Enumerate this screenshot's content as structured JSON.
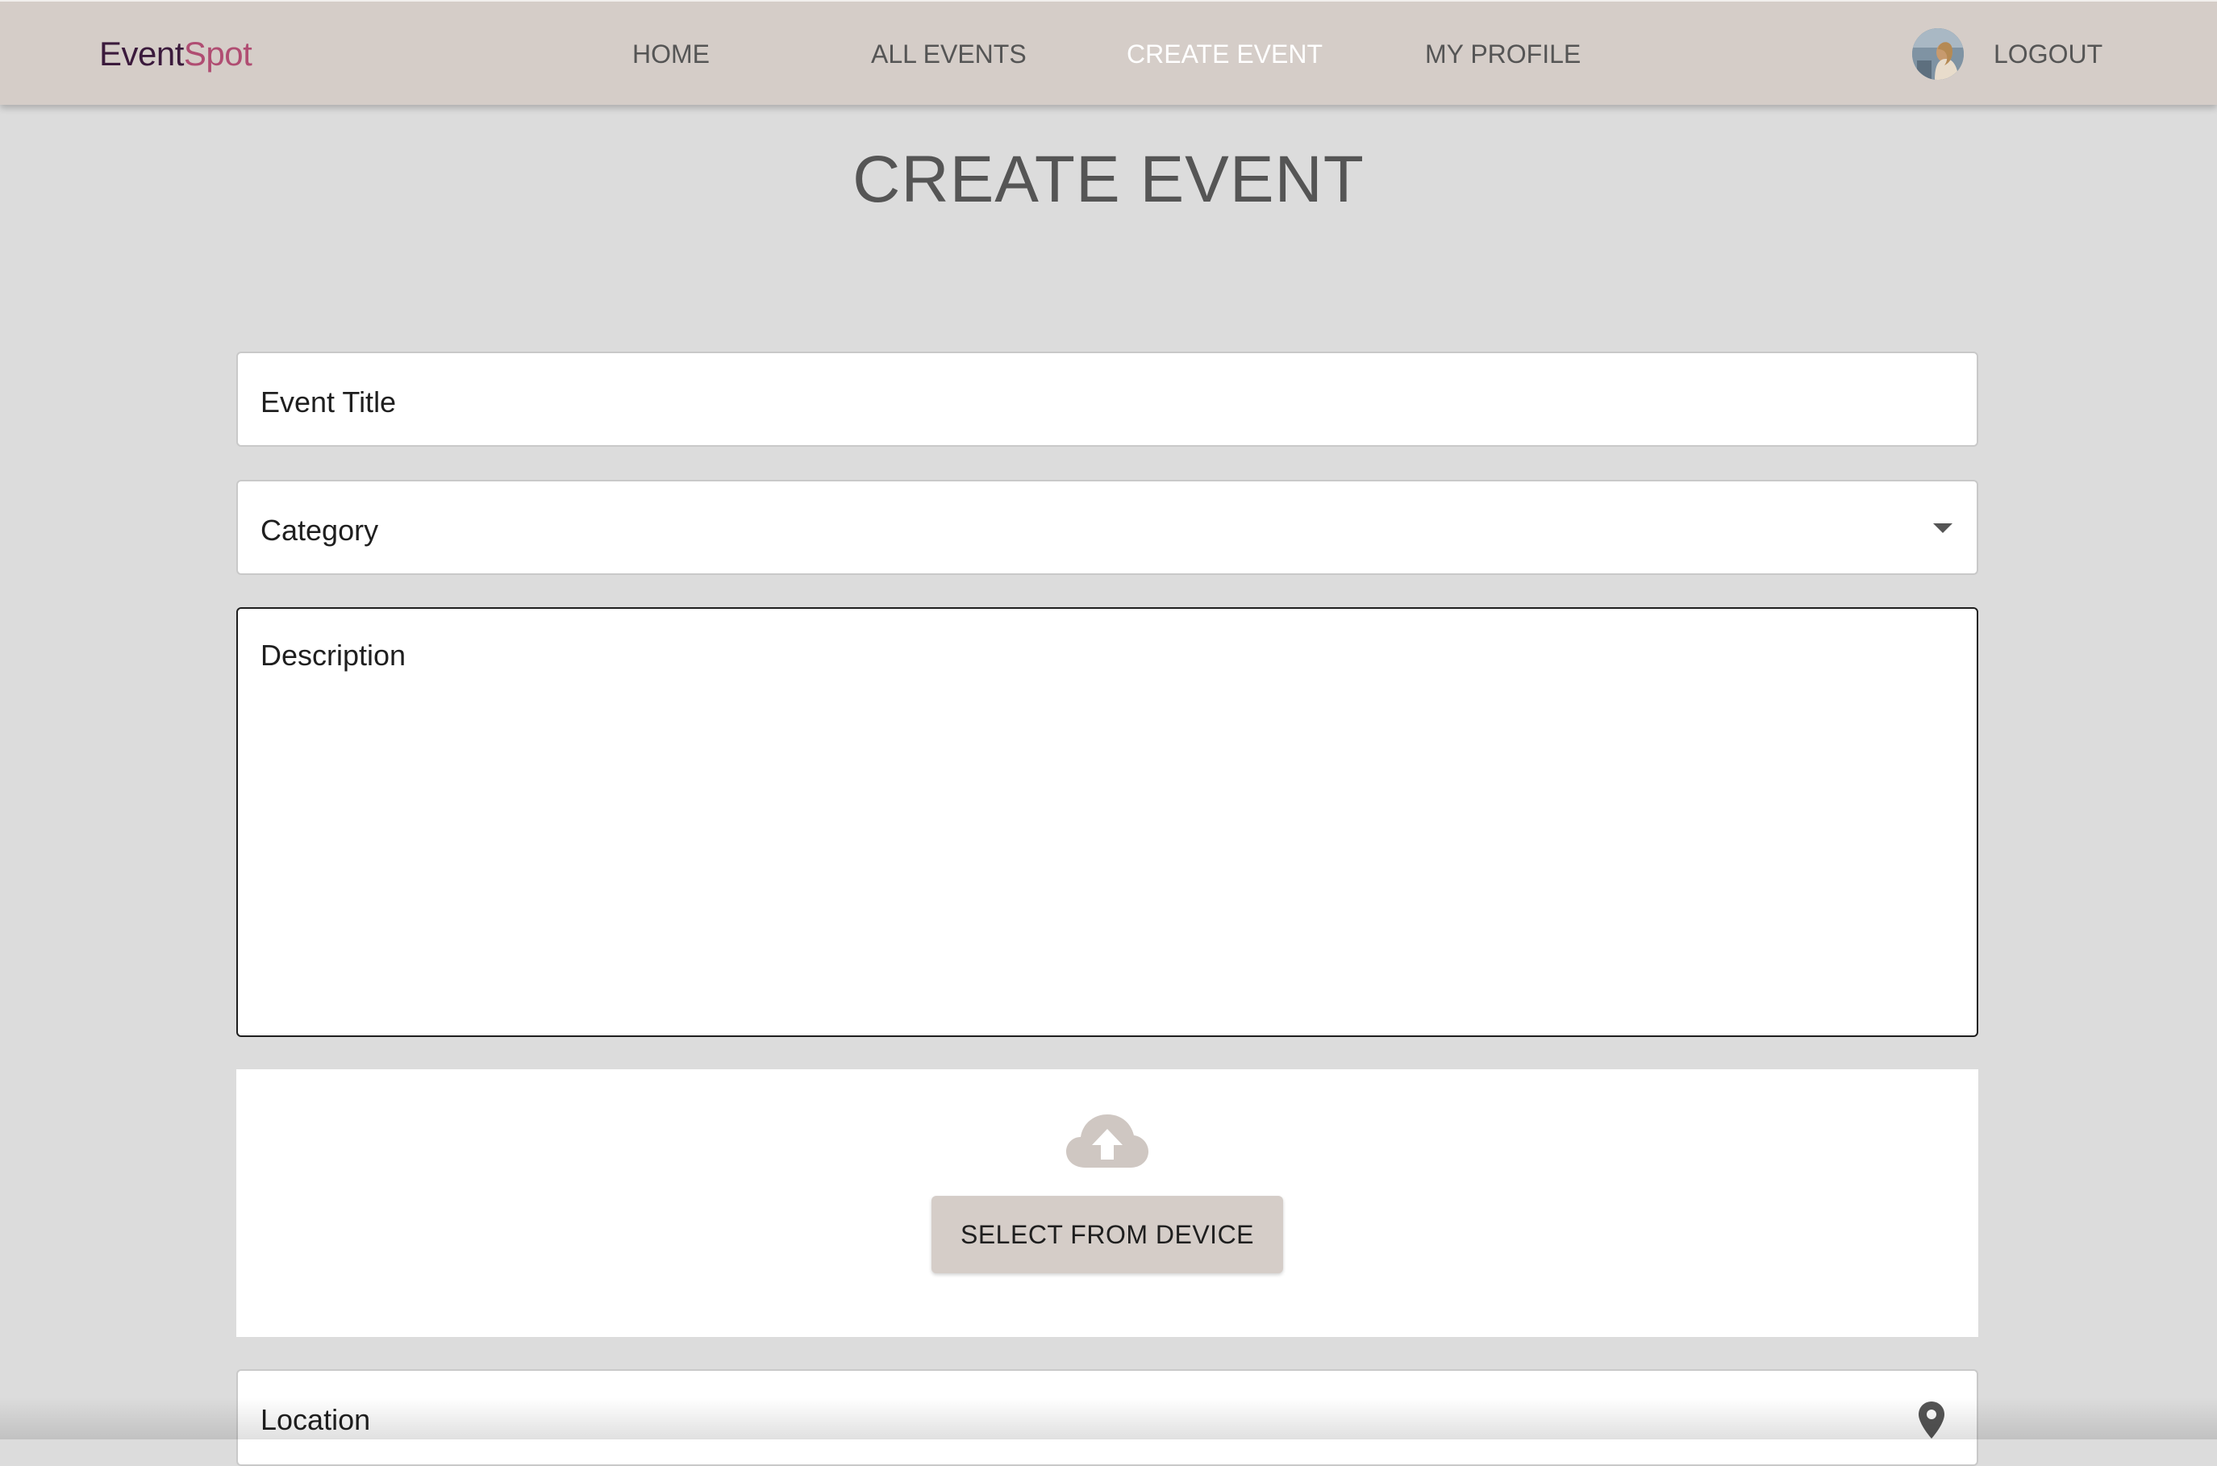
{
  "navbar": {
    "brand_part1": "Event",
    "brand_part2": "Spot",
    "links": [
      {
        "label": "HOME",
        "active": false
      },
      {
        "label": "ALL EVENTS",
        "active": false
      },
      {
        "label": "CREATE EVENT",
        "active": true
      },
      {
        "label": "MY PROFILE",
        "active": false
      }
    ],
    "logout_label": "LOGOUT"
  },
  "page": {
    "title": "CREATE EVENT"
  },
  "form": {
    "event_title_label": "Event Title",
    "category_label": "Category",
    "description_label": "Description",
    "upload_button_label": "SELECT FROM DEVICE",
    "location_label": "Location"
  },
  "icons": {
    "upload": "cloud-upload-icon",
    "dropdown": "caret-down-icon",
    "location": "map-pin-icon",
    "avatar": "user-avatar"
  },
  "colors": {
    "navbar_bg": "#d5cdc8",
    "page_bg": "#dcdcdc",
    "brand_dark": "#3b1a3c",
    "brand_accent": "#b04d72",
    "nav_text": "#555555",
    "nav_active": "#ffffff",
    "upload_icon": "#cfc7c2"
  }
}
